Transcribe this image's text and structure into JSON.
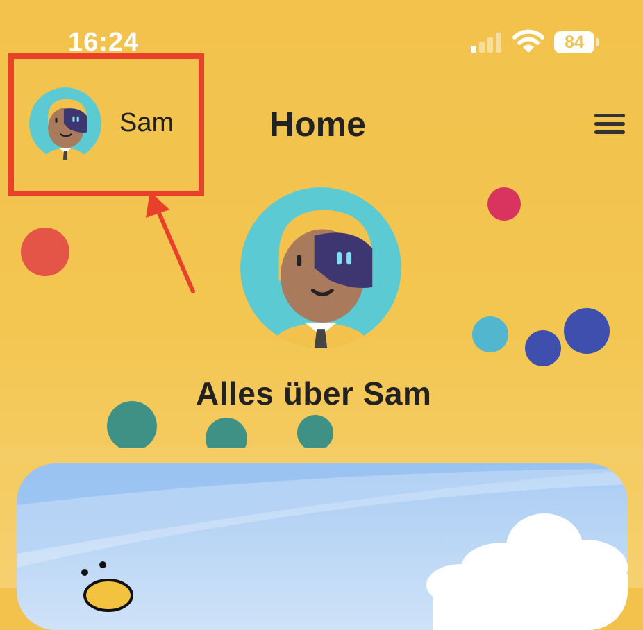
{
  "status_bar": {
    "time": "16:24",
    "battery_level": "84"
  },
  "header": {
    "user_name": "Sam",
    "title": "Home"
  },
  "profile": {
    "heading": "Alles über Sam"
  },
  "colors": {
    "background": "#f2c24c",
    "highlight": "#e8402a",
    "avatar_ring": "#5bcad3",
    "dot_red": "#e45447",
    "dot_pink": "#d8345f",
    "dot_cyan": "#52b6cf",
    "dot_blue": "#3f4fae",
    "dot_teal": "#3f9186"
  },
  "icons": {
    "menu": "hamburger-menu-icon",
    "wifi": "wifi-icon",
    "signal": "cellular-signal-icon",
    "battery": "battery-icon"
  }
}
